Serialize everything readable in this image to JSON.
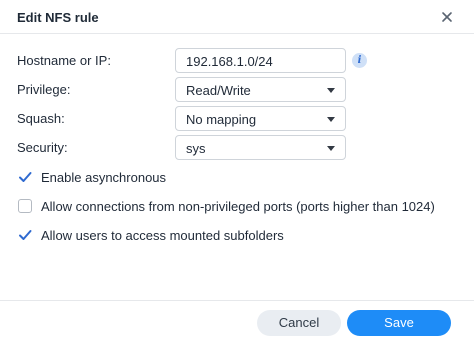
{
  "dialog": {
    "title": "Edit NFS rule",
    "close_icon": "close-icon"
  },
  "form": {
    "hostname": {
      "label": "Hostname or IP:",
      "value": "192.168.1.0/24",
      "info_icon": "info-icon"
    },
    "privilege": {
      "label": "Privilege:",
      "value": "Read/Write"
    },
    "squash": {
      "label": "Squash:",
      "value": "No mapping"
    },
    "security": {
      "label": "Security:",
      "value": "sys"
    }
  },
  "options": [
    {
      "label": "Enable asynchronous",
      "checked": true
    },
    {
      "label": "Allow connections from non-privileged ports (ports higher than 1024)",
      "checked": false
    },
    {
      "label": "Allow users to access mounted subfolders",
      "checked": true
    }
  ],
  "footer": {
    "cancel_label": "Cancel",
    "save_label": "Save"
  },
  "colors": {
    "accent": "#1e8cf7",
    "checkbox": "#2f6ad0",
    "cancel_bg": "#e9edf2"
  }
}
